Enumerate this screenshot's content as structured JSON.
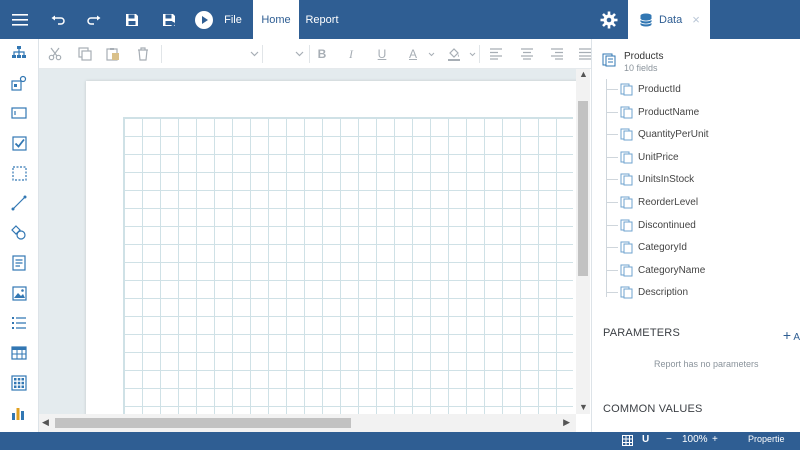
{
  "topbar": {
    "file_label": "File",
    "tabs": [
      {
        "label": "Home",
        "active": true
      },
      {
        "label": "Report",
        "active": false
      }
    ],
    "data_tab_label": "Data",
    "close_glyph": "×"
  },
  "toolbox": {
    "tools": [
      {
        "name": "hierarchy-icon"
      },
      {
        "name": "group-shapes-icon"
      },
      {
        "name": "textbox-icon"
      },
      {
        "name": "checkbox-icon"
      },
      {
        "name": "rectangle-icon"
      },
      {
        "name": "line-icon"
      },
      {
        "name": "shape-icon"
      },
      {
        "name": "richtext-icon"
      },
      {
        "name": "image-icon"
      },
      {
        "name": "list-icon"
      },
      {
        "name": "table-icon"
      },
      {
        "name": "tablix-icon"
      },
      {
        "name": "chart-icon"
      }
    ]
  },
  "format": {
    "bold": "B",
    "italic": "I",
    "underline": "U",
    "font_color": "A"
  },
  "data_panel": {
    "dataset_name": "Products",
    "dataset_subtitle": "10 fields",
    "fields": [
      "ProductId",
      "ProductName",
      "QuantityPerUnit",
      "UnitPrice",
      "UnitsInStock",
      "ReorderLevel",
      "Discontinued",
      "CategoryId",
      "CategoryName",
      "Description"
    ],
    "parameters_title": "PARAMETERS",
    "parameters_add": "A",
    "parameters_empty": "Report has no parameters",
    "common_values_title": "COMMON VALUES"
  },
  "statusbar": {
    "zoom": "100%",
    "zoom_minus": "−",
    "zoom_plus": "+",
    "properties_label": "Propertie"
  },
  "colors": {
    "accent": "#2f5e93",
    "icon_blue": "#3277b3"
  }
}
